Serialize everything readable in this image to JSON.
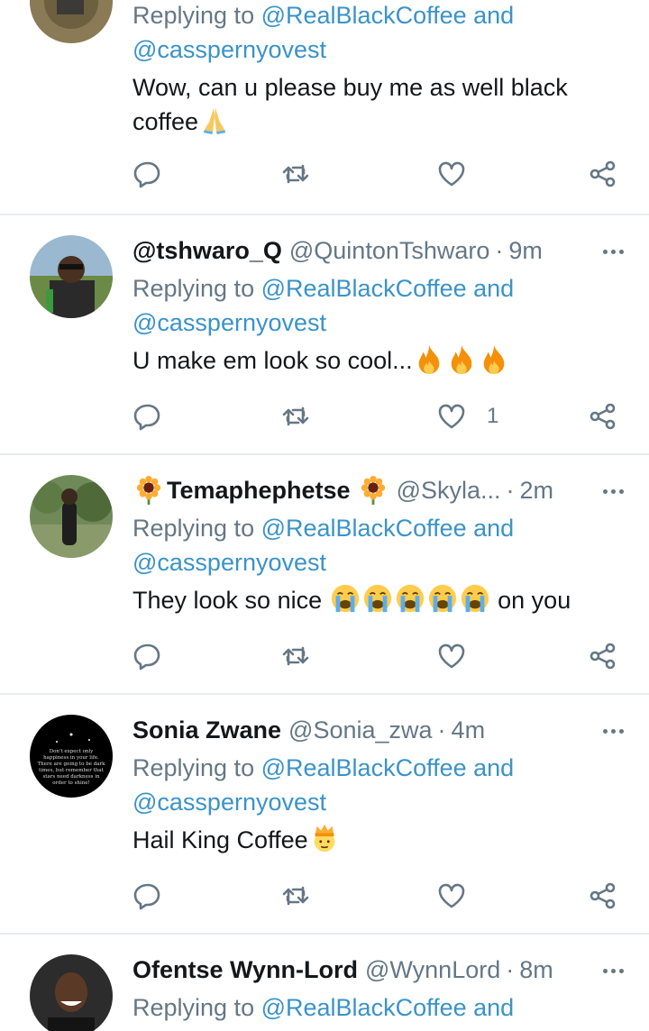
{
  "tweets": [
    {
      "name": "",
      "handle": "",
      "time": "",
      "replying_prefix": "Replying to",
      "reply_mention_1": "@RealBlackCoffee and",
      "reply_mention_2": "@casspernyovest",
      "text_line_1": "Wow, can u please buy me as well black",
      "text_line_2": "coffee",
      "emoji": "folded-hands",
      "like_count": ""
    },
    {
      "name": "@tshwaro_Q",
      "handle": "@QuintonTshwaro",
      "time": "9m",
      "replying_prefix": "Replying to",
      "reply_mention_1": "@RealBlackCoffee and",
      "reply_mention_2": "@casspernyovest",
      "text": "U make em look so cool...",
      "emoji": "fire x3",
      "like_count": "1"
    },
    {
      "name": "Temaphephetse",
      "handle": "@Skyla...",
      "time": "2m",
      "replying_prefix": "Replying to",
      "reply_mention_1": "@RealBlackCoffee and",
      "reply_mention_2": "@casspernyovest",
      "text_before": "They look so nice",
      "text_after": "on you",
      "emoji": "loudly-crying x5",
      "like_count": ""
    },
    {
      "name": "Sonia Zwane",
      "handle": "@Sonia_zwa",
      "time": "4m",
      "replying_prefix": "Replying to",
      "reply_mention_1": "@RealBlackCoffee and",
      "reply_mention_2": "@casspernyovest",
      "text": "Hail King Coffee",
      "emoji": "person-with-crown",
      "avatar_text": [
        "Don't expect only",
        "happiness in your life.",
        "There are going to be dark",
        "times, but remember that",
        "stars need darkness in",
        "order to shine!"
      ],
      "like_count": ""
    },
    {
      "name": "Ofentse Wynn-Lord",
      "handle": "@WynnLord",
      "time": "8m",
      "replying_prefix": "Replying to",
      "reply_mention_1": "@RealBlackCoffee and"
    }
  ],
  "separator_dot": "·",
  "colors": {
    "link": "#3a93c9",
    "muted": "#657786",
    "text": "#14171a",
    "divider": "#e6ecf0"
  }
}
